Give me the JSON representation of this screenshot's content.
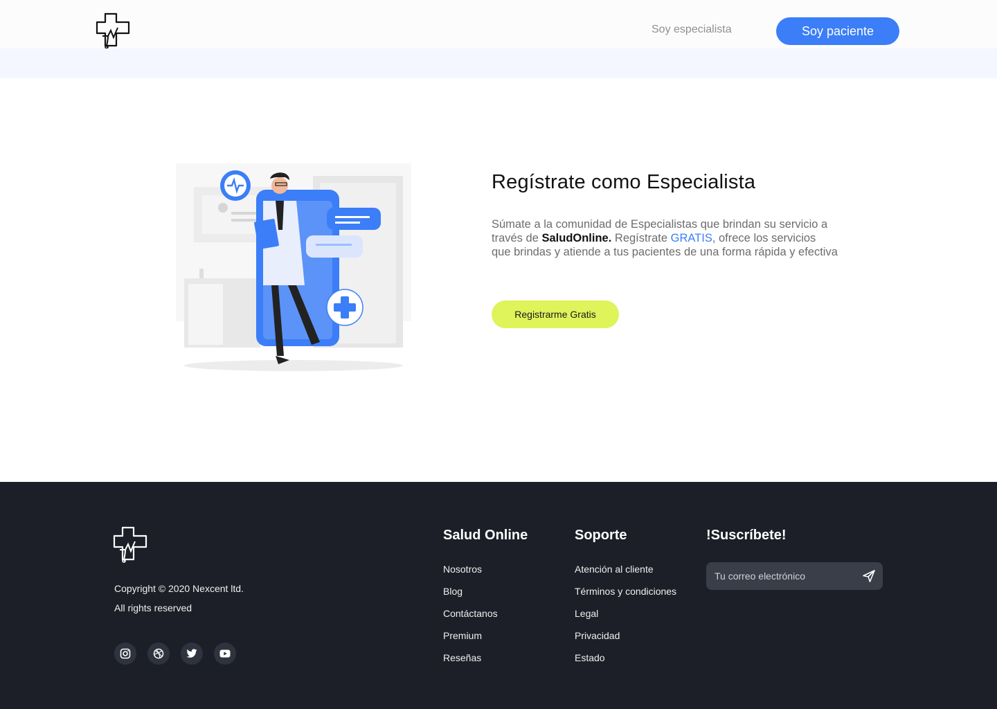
{
  "header": {
    "logo_icon": "medical-cross-logo-icon",
    "nav_link": "Soy especialista",
    "nav_button": "Soy paciente"
  },
  "hero": {
    "title": "Regístrate como Especialista",
    "text_part1": "Súmate a la comunidad de Especialistas que brindan su servicio a través de ",
    "brand": "SaludOnline.",
    "text_part2": " Regístrate ",
    "accent": "GRATIS",
    "text_part3": ", ofrece los servicios que brindas y atiende a tus pacientes de una forma rápida y efectiva",
    "cta": "Registrarme Gratis"
  },
  "footer": {
    "copyright": "Copyright © 2020 Nexcent ltd.",
    "rights": "All rights reserved",
    "social_icons": [
      "instagram-icon",
      "dribbble-icon",
      "twitter-icon",
      "youtube-icon"
    ],
    "columns": [
      {
        "title": "Salud Online",
        "items": [
          "Nosotros",
          "Blog",
          "Contáctanos",
          "Premium",
          "Reseñas"
        ]
      },
      {
        "title": "Soporte",
        "items": [
          "Atención al cliente",
          "Términos y condiciones",
          "Legal",
          "Privacidad",
          "Estado"
        ]
      }
    ],
    "subscribe_title": "!Suscríbete!",
    "subscribe_placeholder": "Tu correo electrónico",
    "send_icon": "send-icon"
  },
  "colors": {
    "primary": "#3b7ef7",
    "cta": "#dff35a",
    "footer_bg": "#1c1f27"
  }
}
